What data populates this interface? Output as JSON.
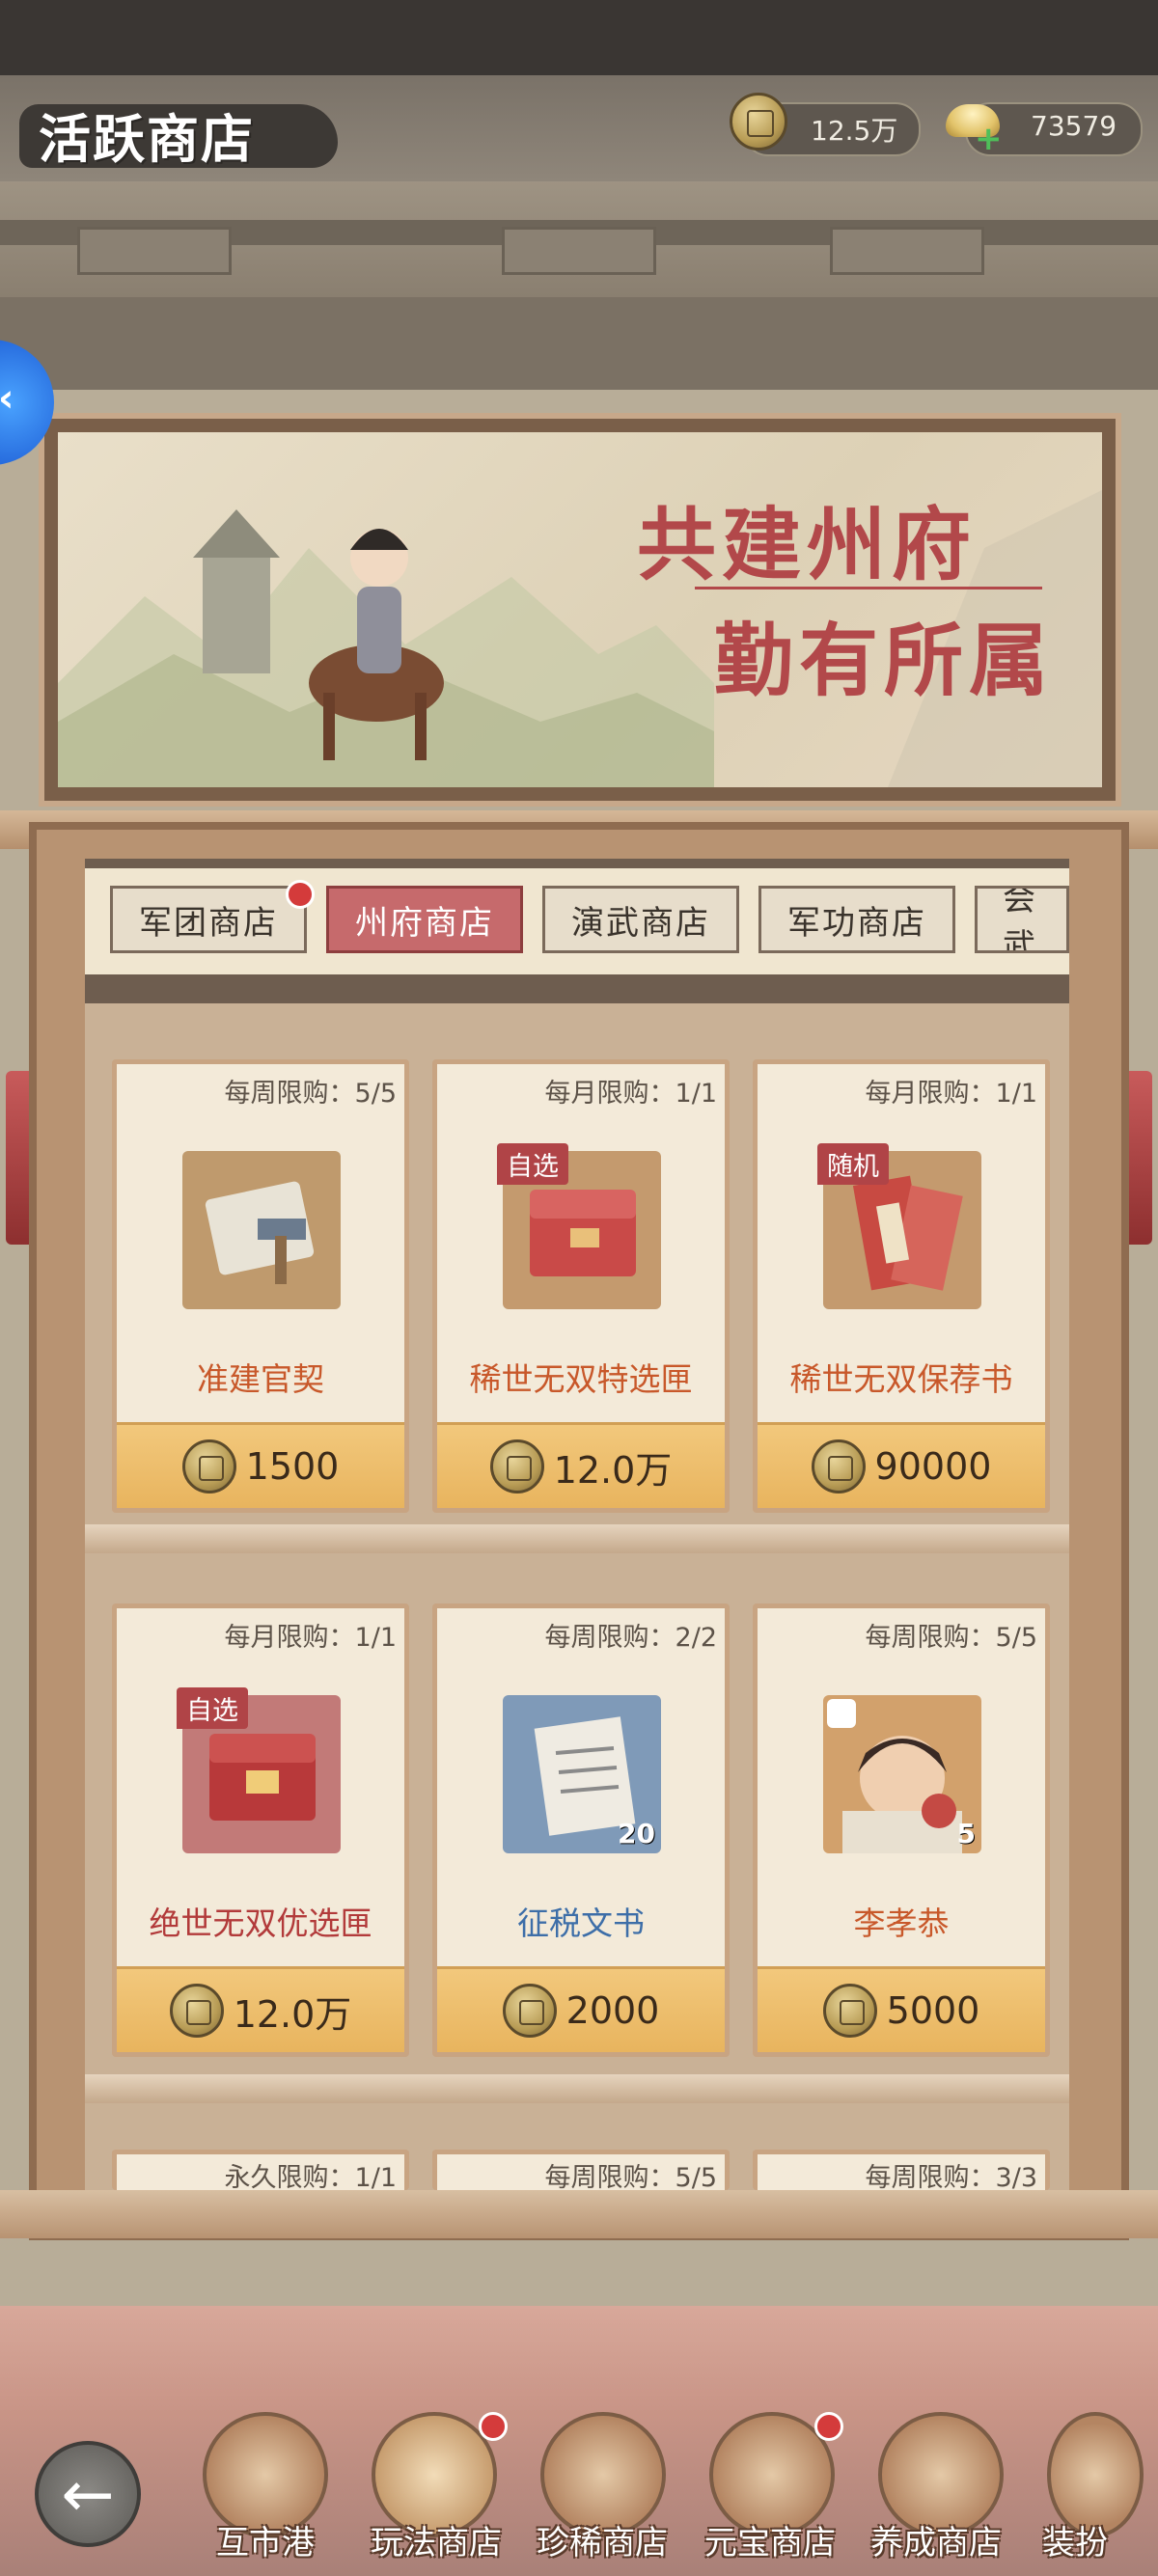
{
  "header": {
    "title": "活跃商店",
    "coin_value": "12.5万",
    "ingot_value": "73579"
  },
  "banner": {
    "line1": "共建州府",
    "line2": "勤有所属"
  },
  "tabs": [
    {
      "label": "军团商店"
    },
    {
      "label": "州府商店"
    },
    {
      "label": "演武商店"
    },
    {
      "label": "军功商店"
    },
    {
      "label": "会武"
    }
  ],
  "items": [
    {
      "limit": "每周限购：5/5",
      "name": "准建官契",
      "price": "1500",
      "tag": ""
    },
    {
      "limit": "每月限购：1/1",
      "name": "稀世无双特选匣",
      "price": "12.0万",
      "tag": "自选"
    },
    {
      "limit": "每月限购：1/1",
      "name": "稀世无双保荐书",
      "price": "90000",
      "tag": "随机"
    },
    {
      "limit": "每月限购：1/1",
      "name": "绝世无双优选匣",
      "price": "12.0万",
      "tag": "自选"
    },
    {
      "limit": "每周限购：2/2",
      "name": "征税文书",
      "price": "2000",
      "tag": "",
      "count": "20"
    },
    {
      "limit": "每周限购：5/5",
      "name": "李孝恭",
      "price": "5000",
      "tag": "",
      "count": "5"
    }
  ],
  "partial_items": [
    {
      "limit": "永久限购：1/1"
    },
    {
      "limit": "每周限购：5/5"
    },
    {
      "limit": "每周限购：3/3"
    }
  ],
  "nav": [
    {
      "label": "互市港"
    },
    {
      "label": "玩法商店"
    },
    {
      "label": "珍稀商店"
    },
    {
      "label": "元宝商店"
    },
    {
      "label": "养成商店"
    },
    {
      "label": "装扮"
    }
  ],
  "colors": {
    "active_tab": "#c66a6c",
    "price_bar": "#f0c273",
    "name_orange": "#c8582a",
    "name_red": "#b23a3a",
    "name_blue": "#3d6ea8"
  }
}
